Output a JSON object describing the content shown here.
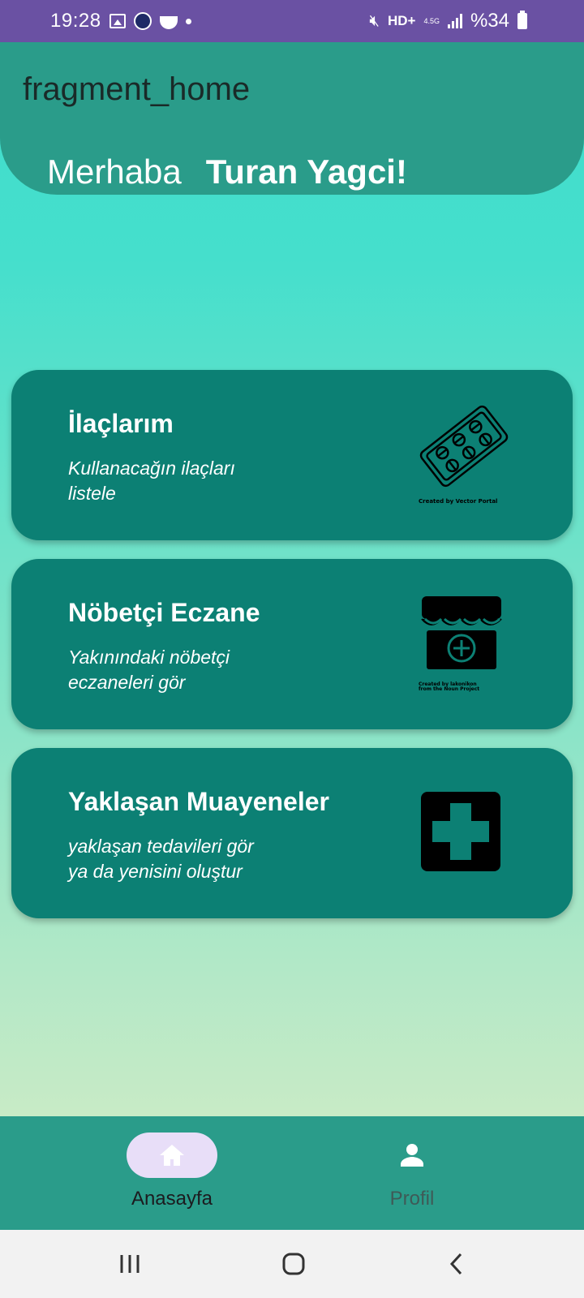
{
  "status_bar": {
    "time": "19:28",
    "network": "HD+",
    "network_type": "4.5G",
    "battery": "%34",
    "icons": [
      "gallery-icon",
      "app-notification-icon",
      "cooking-app-icon",
      "dot-icon",
      "mute-icon",
      "signal-icon",
      "battery-icon"
    ]
  },
  "header": {
    "title": "fragment_home",
    "greeting": "Merhaba",
    "user_name": "Turan Yagci!"
  },
  "cards": [
    {
      "title": "İlaçlarım",
      "subtitle_line1": "Kullanacağın ilaçları",
      "subtitle_line2": "listele",
      "icon": "pill-blister-icon",
      "credit": "Created by Vector Portal"
    },
    {
      "title": "Nöbetçi Eczane",
      "subtitle_line1": "Yakınındaki nöbetçi",
      "subtitle_line2": "eczaneleri gör",
      "icon": "pharmacy-store-icon",
      "credit_line1": "Created by lakonikon",
      "credit_line2": "from the Noun Project"
    },
    {
      "title": "Yaklaşan Muayeneler",
      "subtitle_line1": "yaklaşan tedavileri gör",
      "subtitle_line2": "ya da yenisini oluştur",
      "icon": "medical-cross-icon"
    }
  ],
  "bottom_nav": {
    "items": [
      {
        "label": "Anasayfa",
        "icon": "home-icon",
        "selected": true
      },
      {
        "label": "Profil",
        "icon": "person-icon",
        "selected": false
      }
    ]
  },
  "colors": {
    "status_bar": "#6a51a3",
    "header": "#2a9c8a",
    "card": "#0c8074",
    "nav_pill": "#e8def8"
  }
}
